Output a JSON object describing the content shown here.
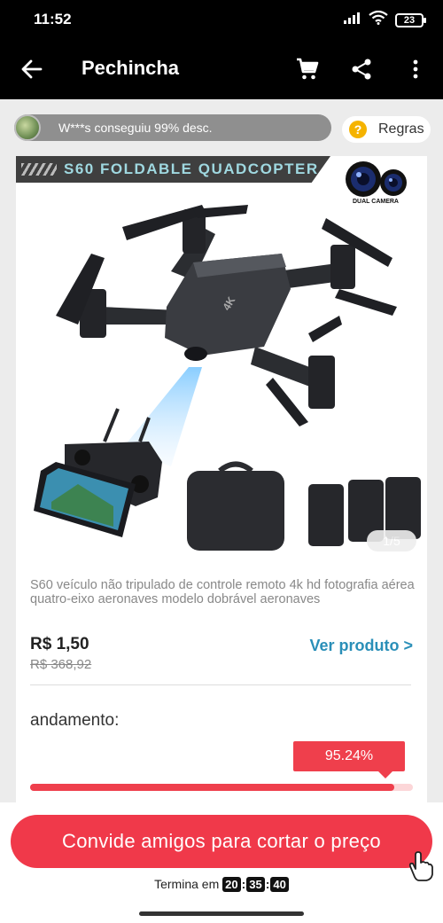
{
  "status": {
    "time": "11:52",
    "battery": "23",
    "icons": [
      "signal-icon",
      "wifi-icon",
      "battery-icon"
    ]
  },
  "appbar": {
    "title": "Pechincha",
    "icons": [
      "back-arrow-icon",
      "cart-icon",
      "share-icon",
      "more-vert-icon"
    ]
  },
  "ticker": {
    "text": "W***s conseguiu 99% desc."
  },
  "rules": {
    "label": "Regras",
    "icon": "question-icon"
  },
  "product": {
    "banner": "S60 FOLDABLE QUADCOPTER",
    "camera_label": "DUAL CAMERA",
    "drone_mark": "4K",
    "image_index": "1",
    "image_total": "5",
    "pager_sep": "/",
    "description": "S60 veículo não tripulado de controle remoto 4k hd fotografia aérea quatro-eixo aeronaves modelo dobrável aeronaves",
    "price": "R$ 1,50",
    "old_price": "R$ 368,92",
    "view_link": "Ver produto >"
  },
  "progress": {
    "label": "andamento:",
    "percent_text": "95.24%",
    "percent": 95.24
  },
  "cta": {
    "label": "Convide amigos para cortar o preço",
    "ends_label": "Termina em",
    "hours": "20",
    "minutes": "35",
    "seconds": "40",
    "sep": ":"
  },
  "colors": {
    "accent": "#f0394a",
    "link": "#2a8fb8",
    "rules_icon": "#f5b300"
  }
}
